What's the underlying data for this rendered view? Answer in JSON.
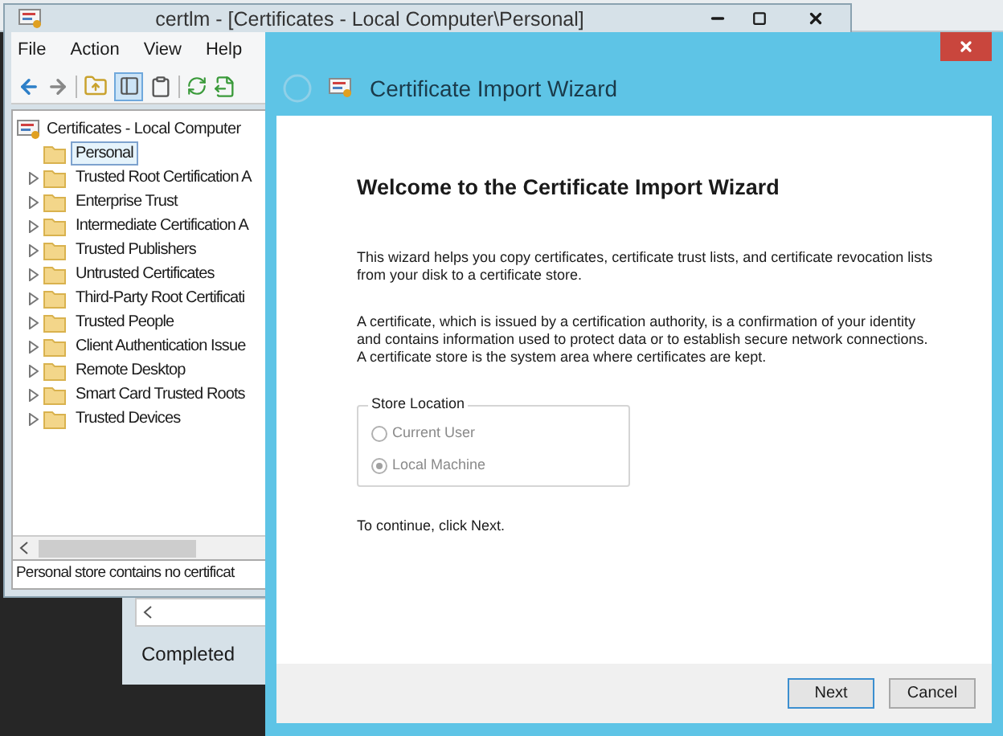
{
  "console_window": {
    "title": "certlm - [Certificates - Local Computer\\Personal]",
    "menu": [
      "File",
      "Action",
      "View",
      "Help"
    ],
    "tree": {
      "label": "Certificates - Local Computer",
      "children": [
        {
          "label": "Personal",
          "selected": true,
          "expandable": false
        },
        {
          "label": "Trusted Root Certification A",
          "selected": false,
          "expandable": true
        },
        {
          "label": "Enterprise Trust",
          "selected": false,
          "expandable": true
        },
        {
          "label": "Intermediate Certification A",
          "selected": false,
          "expandable": true
        },
        {
          "label": "Trusted Publishers",
          "selected": false,
          "expandable": true
        },
        {
          "label": "Untrusted Certificates",
          "selected": false,
          "expandable": true
        },
        {
          "label": "Third-Party Root Certificati",
          "selected": false,
          "expandable": true
        },
        {
          "label": "Trusted People",
          "selected": false,
          "expandable": true
        },
        {
          "label": "Client Authentication Issue",
          "selected": false,
          "expandable": true
        },
        {
          "label": "Remote Desktop",
          "selected": false,
          "expandable": true
        },
        {
          "label": "Smart Card Trusted Roots",
          "selected": false,
          "expandable": true
        },
        {
          "label": "Trusted Devices",
          "selected": false,
          "expandable": true
        }
      ]
    },
    "status_bar": "Personal store contains no certificat"
  },
  "background_window": {
    "status": "Completed"
  },
  "wizard": {
    "title": "Certificate Import Wizard",
    "heading": "Welcome to the Certificate Import Wizard",
    "paragraphs": [
      "This wizard helps you copy certificates, certificate trust lists, and certificate revocation lists from your disk to a certificate store.",
      "A certificate, which is issued by a certification authority, is a confirmation of your identity and contains information used to protect data or to establish secure network connections. A certificate store is the system area where certificates are kept."
    ],
    "store_location": {
      "label": "Store Location",
      "options": [
        {
          "label": "Current User",
          "selected": false,
          "disabled": true
        },
        {
          "label": "Local Machine",
          "selected": true,
          "disabled": true
        }
      ]
    },
    "hint": "To continue, click Next.",
    "buttons": [
      {
        "label": "Next",
        "default": true
      },
      {
        "label": "Cancel",
        "default": false
      }
    ]
  }
}
